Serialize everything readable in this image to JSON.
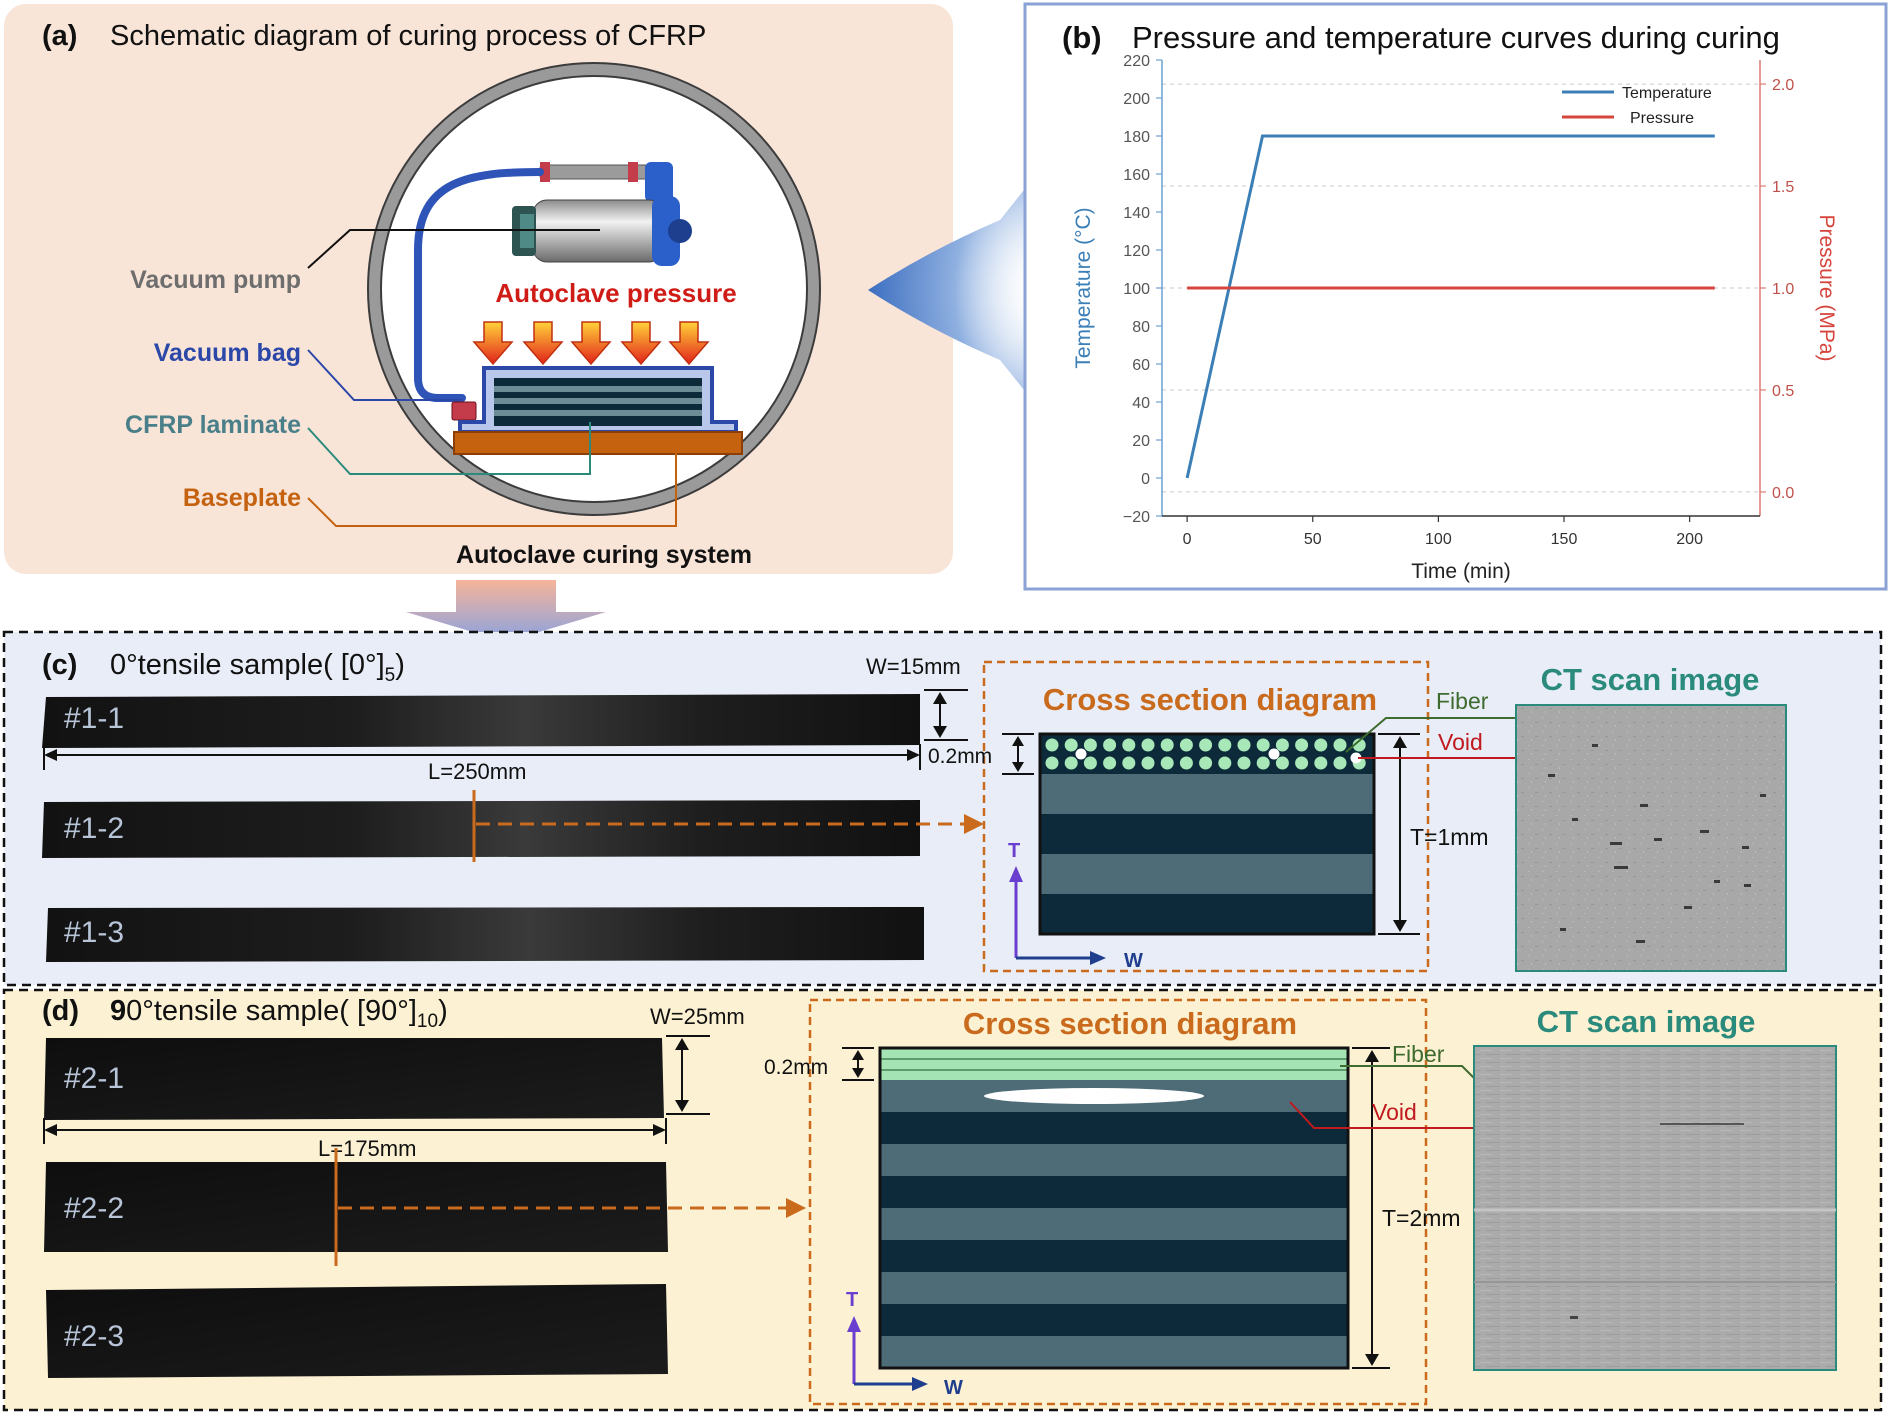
{
  "panel_a": {
    "title_tag": "(a)",
    "title": "Schematic diagram of curing process of CFRP",
    "labels": {
      "vacuum_pump": "Vacuum pump",
      "vacuum_bag": "Vacuum bag",
      "cfrp_laminate": "CFRP laminate",
      "baseplate": "Baseplate",
      "autoclave_pressure": "Autoclave pressure",
      "system": "Autoclave curing system"
    }
  },
  "panel_b": {
    "title_tag": "(b)",
    "title": "Pressure and temperature curves during curing"
  },
  "chart_data": {
    "type": "line",
    "title": "",
    "xlabel": "Time (min)",
    "ylabel": "Temperature (°C)",
    "y2label": "Pressure (MPa)",
    "xlim": [
      -10,
      228
    ],
    "ylim": [
      -20,
      220
    ],
    "y2lim": [
      -0.118,
      2.118
    ],
    "xticks": [
      0,
      50,
      100,
      150,
      200
    ],
    "yticks": [
      -20,
      0,
      20,
      40,
      60,
      80,
      100,
      120,
      140,
      160,
      180,
      200,
      220
    ],
    "y2ticks": [
      0.0,
      0.5,
      1.0,
      1.5,
      2.0
    ],
    "ytick_labels": [
      "−20",
      "0",
      "20",
      "40",
      "60",
      "80",
      "100",
      "120",
      "140",
      "160",
      "180",
      "200",
      "220"
    ],
    "xtick_labels": [
      "0",
      "50",
      "100",
      "150",
      "200"
    ],
    "y2tick_labels": [
      "0.0",
      "0.5",
      "1.0",
      "1.5",
      "2.0"
    ],
    "legend_position": "top-right",
    "grid": "dashed horizontal at right-axis ticks",
    "series": [
      {
        "name": "Temperature",
        "axis": "left",
        "color": "#3b7fb6",
        "x": [
          0,
          30,
          210
        ],
        "y": [
          0,
          180,
          180
        ]
      },
      {
        "name": "Pressure",
        "axis": "right",
        "color": "#d6453d",
        "x": [
          0,
          210
        ],
        "y": [
          1.0,
          1.0
        ]
      }
    ]
  },
  "panel_c": {
    "title_tag": "(c)",
    "title": "0°tensile sample( [0°]",
    "title_sub": "5",
    "title_end": ")",
    "samples": [
      "#1-1",
      "#1-2",
      "#1-3"
    ],
    "width_label": "W=15mm",
    "length_label": "L=250mm",
    "ply_label": "0.2mm",
    "thickness_label": "T=1mm",
    "cross_title": "Cross section diagram",
    "ct_title": "CT scan image",
    "fiber_label": "Fiber",
    "void_label": "Void",
    "axis_t": "T",
    "axis_w": "W"
  },
  "panel_d": {
    "title_tag": "(d)",
    "title_bold": "9",
    "title": "0°tensile sample( [90°]",
    "title_sub": "10",
    "title_end": ")",
    "samples": [
      "#2-1",
      "#2-2",
      "#2-3"
    ],
    "width_label": "W=25mm",
    "length_label": "L=175mm",
    "ply_label": "0.2mm",
    "thickness_label": "T=2mm",
    "cross_title": "Cross section diagram",
    "ct_title": "CT scan image",
    "fiber_label": "Fiber",
    "void_label": "Void",
    "axis_t": "T",
    "axis_w": "W"
  },
  "colors": {
    "panel_a_bg": "#f9e5d8",
    "panel_c_bg": "#e8edf7",
    "panel_d_bg": "#fcf1d2",
    "orange": "#c96a1c",
    "dark_ply": "#0d2a3a",
    "light_ply": "#4d6c78",
    "fiber_dot": "#a8e8b8",
    "void_red": "#c0191e",
    "fiber_green": "#3e6b2e",
    "ct_title": "#2a8a7c",
    "vacuum_bag_blue": "#2b47a8",
    "pressure_red": "#d01c17"
  }
}
